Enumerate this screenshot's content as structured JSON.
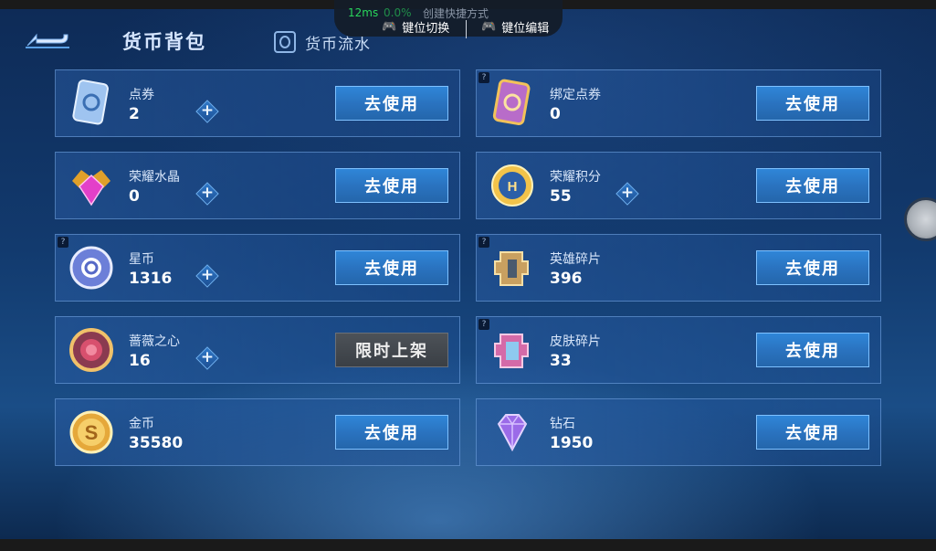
{
  "header": {
    "title": "货币背包",
    "flow_label": "货币流水"
  },
  "overlay": {
    "ping": "12ms",
    "percent": "0.0%",
    "faint_label": "创建快捷方式",
    "switch_label": "键位切换",
    "edit_label": "键位编辑"
  },
  "currencies": [
    {
      "name": "点券",
      "count": "2",
      "action": "去使用",
      "has_plus": true,
      "has_help": false,
      "icon": "coupon-icon"
    },
    {
      "name": "绑定点券",
      "count": "0",
      "action": "去使用",
      "has_plus": false,
      "has_help": true,
      "icon": "bound-coupon-icon"
    },
    {
      "name": "荣耀水晶",
      "count": "0",
      "action": "去使用",
      "has_plus": true,
      "has_help": false,
      "icon": "glory-crystal-icon"
    },
    {
      "name": "荣耀积分",
      "count": "55",
      "action": "去使用",
      "has_plus": true,
      "has_help": false,
      "icon": "glory-points-icon"
    },
    {
      "name": "星币",
      "count": "1316",
      "action": "去使用",
      "has_plus": true,
      "has_help": true,
      "icon": "star-coin-icon"
    },
    {
      "name": "英雄碎片",
      "count": "396",
      "action": "去使用",
      "has_plus": false,
      "has_help": true,
      "icon": "hero-fragment-icon"
    },
    {
      "name": "蔷薇之心",
      "count": "16",
      "action": "限时上架",
      "has_plus": true,
      "has_help": false,
      "icon": "rose-heart-icon"
    },
    {
      "name": "皮肤碎片",
      "count": "33",
      "action": "去使用",
      "has_plus": false,
      "has_help": true,
      "icon": "skin-fragment-icon"
    },
    {
      "name": "金币",
      "count": "35580",
      "action": "去使用",
      "has_plus": false,
      "has_help": false,
      "icon": "gold-coin-icon"
    },
    {
      "name": "钻石",
      "count": "1950",
      "action": "去使用",
      "has_plus": false,
      "has_help": false,
      "icon": "diamond-icon"
    }
  ],
  "colors": {
    "background": "#123a6e",
    "button_blue": "#2a73c0",
    "button_disabled": "#3a3f45"
  }
}
